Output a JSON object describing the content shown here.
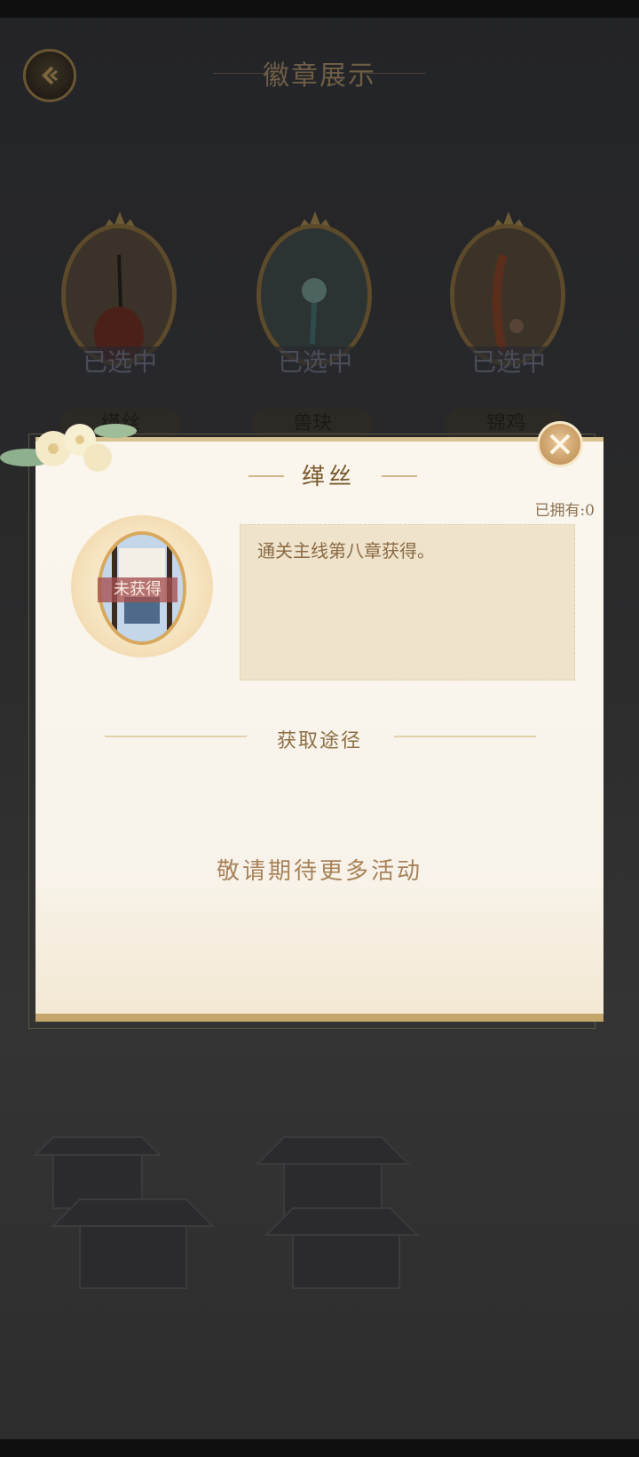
{
  "header": {
    "title": "徽章展示",
    "back_icon": "back-arrow-icon"
  },
  "badges": [
    {
      "name": "缂丝",
      "selected_label": "已选中"
    },
    {
      "name": "兽玦",
      "selected_label": "已选中"
    },
    {
      "name": "锦鸡",
      "selected_label": "已选中"
    }
  ],
  "dialog": {
    "title": "缂丝",
    "owned": "已拥有:0",
    "status": "未获得",
    "description": "通关主线第八章获得。",
    "acquire_title": "获取途径",
    "coming_soon": "敬请期待更多活动",
    "close_icon": "close-icon"
  },
  "colors": {
    "accent": "#c79a60",
    "text_brown": "#8a6a44",
    "panel": "#faf6ee"
  }
}
